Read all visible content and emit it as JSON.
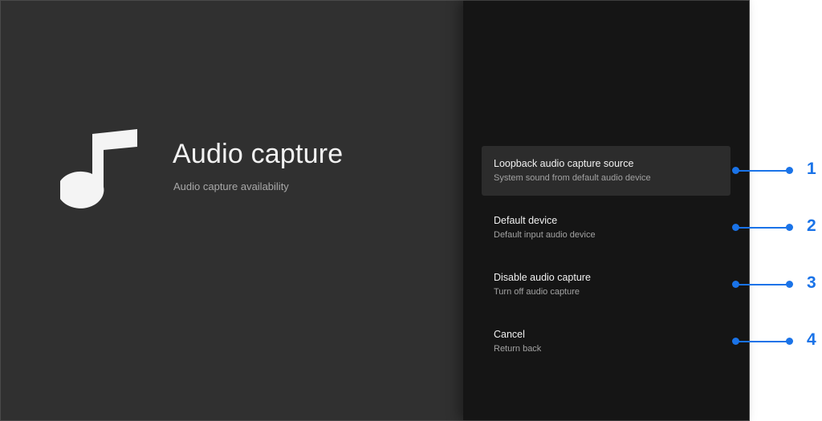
{
  "header": {
    "title": "Audio capture",
    "subtitle": "Audio capture availability",
    "icon": "music-note-icon"
  },
  "menu": {
    "items": [
      {
        "label": "Loopback audio capture source",
        "description": "System sound from default audio device",
        "selected": true
      },
      {
        "label": "Default device",
        "description": "Default input audio device",
        "selected": false
      },
      {
        "label": "Disable audio capture",
        "description": "Turn off audio capture",
        "selected": false
      },
      {
        "label": "Cancel",
        "description": "Return back",
        "selected": false
      }
    ]
  },
  "callouts": [
    "1",
    "2",
    "3",
    "4"
  ],
  "colors": {
    "left_background": "#303030",
    "right_background": "#151515",
    "selected_item": "#2c2c2c",
    "callout": "#1a73e8"
  }
}
